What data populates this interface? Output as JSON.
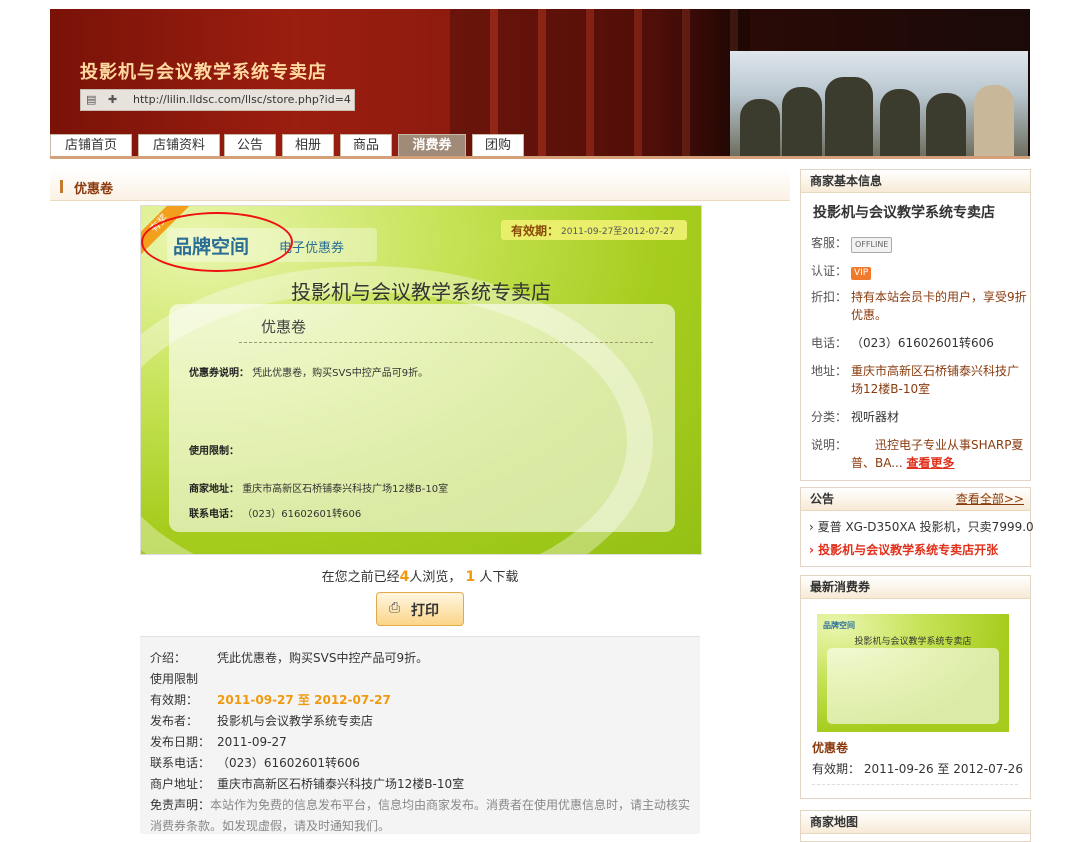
{
  "header": {
    "store_name": "投影机与会议教学系统专卖店",
    "url": "http://lilin.lldsc.com/llsc/store.php?id=4"
  },
  "nav": {
    "tabs": [
      {
        "label": "店铺首页"
      },
      {
        "label": "店铺资料"
      },
      {
        "label": "公告"
      },
      {
        "label": "相册"
      },
      {
        "label": "商品"
      },
      {
        "label": "消费券",
        "active": true
      },
      {
        "label": "团购"
      }
    ]
  },
  "section_title": "优惠卷",
  "coupon": {
    "ribbon": "有奖",
    "brand": "品牌空间",
    "brand_sub": "电子优惠券",
    "valid_label": "有效期：",
    "valid_range": "2011-09-27至2012-07-27",
    "title": "投影机与会议教学系统专卖店",
    "panel_title": "优惠卷",
    "desc_label": "优惠券说明：",
    "desc_value": "凭此优惠卷，购买SVS中控产品可9折。",
    "limit_label": "使用限制：",
    "addr_label": "商家地址：",
    "addr_value": "重庆市高新区石桥铺泰兴科技广场12楼B-10室",
    "phone_label": "联系电话：",
    "phone_value": "（023）61602601转606"
  },
  "stats": {
    "prefix": "在您之前已经",
    "views": "4",
    "mid": "人浏览，",
    "downloads": "1",
    "suffix": " 人下载"
  },
  "print_label": "打印",
  "info": {
    "intro_label": "介绍：",
    "intro_value": "凭此优惠卷，购买SVS中控产品可9折。",
    "limit_label": "使用限制",
    "valid_label": "有效期：",
    "valid_value": "2011-09-27 至 2012-07-27",
    "publisher_label": "发布者：",
    "publisher_value": "投影机与会议教学系统专卖店",
    "date_label": "发布日期：",
    "date_value": "2011-09-27",
    "phone_label": "联系电话：",
    "phone_value": "（023）61602601转606",
    "addr_label": "商户地址：",
    "addr_value": "重庆市高新区石桥铺泰兴科技广场12楼B-10室",
    "disclaimer_label": "免责声明：",
    "disclaimer_value": "本站作为免费的信息发布平台，信息均由商家发布。消费者在使用优惠信息时，请主动核实消费券条款。如发现虚假，请及时通知我们。"
  },
  "merchant": {
    "header": "商家基本信息",
    "name": "投影机与会议教学系统专卖店",
    "service_label": "客服：",
    "service_status": "OFFLINE",
    "cert_label": "认证：",
    "cert_value": "VIP",
    "discount_label": "折扣：",
    "discount_value": "持有本站会员卡的用户，享受9折优惠。",
    "phone_label": "电话：",
    "phone_value": "（023）61602601转606",
    "addr_label": "地址：",
    "addr_value": "重庆市高新区石桥铺泰兴科技广场12楼B-10室",
    "cat_label": "分类：",
    "cat_value": "视听器材",
    "desc_label": "说明：",
    "desc_value": "迅控电子专业从事SHARP夏普、BA...",
    "more": "查看更多"
  },
  "announce": {
    "header": "公告",
    "view_all": "查看全部>>",
    "items": [
      "夏普 XG-D350XA 投影机，只卖7999.0",
      "投影机与会议教学系统专卖店开张"
    ]
  },
  "latest": {
    "header": "最新消费券",
    "thumb_brand": "品牌空间",
    "thumb_title": "投影机与会议教学系统专卖店",
    "name": "优惠卷",
    "valid_label": "有效期：",
    "valid_value": "2011-09-26 至 2012-07-26"
  },
  "map_header": "商家地图",
  "colors": {
    "accent": "#8a3b0e",
    "highlight": "#f09a10",
    "red": "#e1301c"
  }
}
